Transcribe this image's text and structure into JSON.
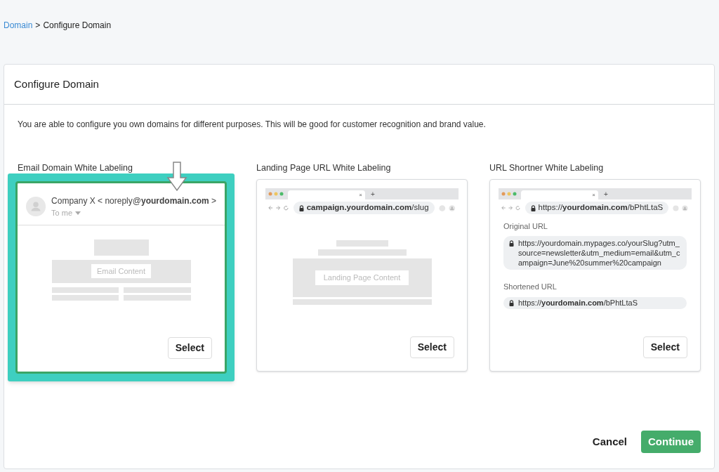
{
  "breadcrumb": {
    "link": "Domain",
    "separator": ">",
    "current": "Configure Domain"
  },
  "panel": {
    "title": "Configure Domain",
    "description": "You are able to configure you own domains for different purposes. This will be good for customer recognition and brand value."
  },
  "options": [
    {
      "kind": "email",
      "label": "Email Domain White Labeling",
      "selected": true,
      "sender": "Company X < noreply@**yourdomain.com** >",
      "recipient": "To me",
      "content_label": "Email Content",
      "button": "Select"
    },
    {
      "kind": "landing",
      "label": "Landing Page URL White Labeling",
      "selected": false,
      "tab_close": "×",
      "tab_new": "+",
      "address": "**campaign.yourdomain.com**/slug",
      "content_label": "Landing Page Content",
      "button": "Select"
    },
    {
      "kind": "shortener",
      "label": "URL Shortner White Labeling",
      "selected": false,
      "tab_close": "×",
      "tab_new": "+",
      "address": "https://**yourdomain.com**/bPhtLtaS",
      "original_label": "Original URL",
      "original_url": "https://yourdomain.mypages.co/yourSlug?utm_source=newsletter&utm_medium=email&utm_campaign=June%20summer%20campaign",
      "shortened_label": "Shortened URL",
      "shortened_url": "https://**yourdomain.com**/bPhtLtaS",
      "button": "Select"
    }
  ],
  "actions": {
    "cancel": "Cancel",
    "continue": "Continue"
  }
}
